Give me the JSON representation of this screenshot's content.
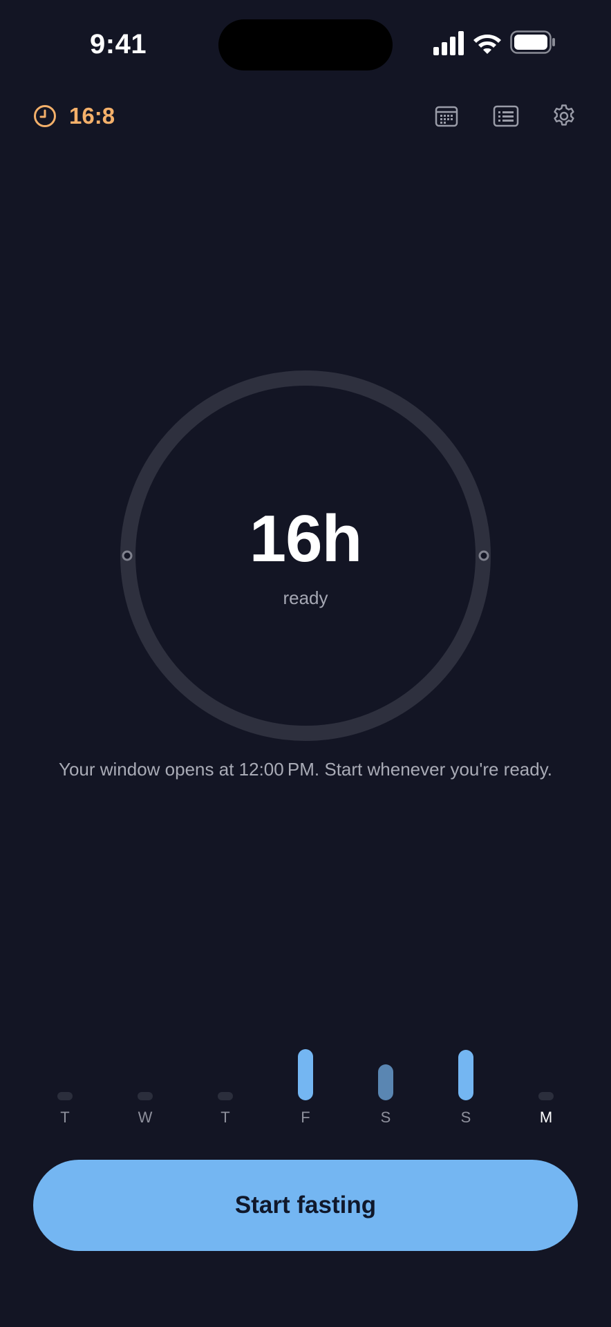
{
  "status_bar": {
    "time": "9:41"
  },
  "header": {
    "plan_label": "16:8",
    "plan_icon": "clock-icon",
    "icons": [
      "calendar-icon",
      "list-icon",
      "gear-icon"
    ]
  },
  "timer": {
    "value": "16h",
    "status": "ready",
    "progress": 0
  },
  "window_message": "Your window opens at 12:00 PM. Start whenever you're ready.",
  "week": {
    "days": [
      {
        "letter": "T",
        "level": 0,
        "shade": "empty"
      },
      {
        "letter": "W",
        "level": 0,
        "shade": "empty"
      },
      {
        "letter": "T",
        "level": 0,
        "shade": "empty"
      },
      {
        "letter": "F",
        "level": 1.0,
        "shade": "full"
      },
      {
        "letter": "S",
        "level": 0.7,
        "shade": "partial"
      },
      {
        "letter": "S",
        "level": 0.98,
        "shade": "full"
      },
      {
        "letter": "M",
        "level": 0,
        "shade": "empty",
        "current": true
      }
    ]
  },
  "actions": {
    "start_label": "Start fasting"
  },
  "colors": {
    "background": "#131524",
    "accent_orange": "#f4b06a",
    "accent_blue": "#74b6f2",
    "bar_partial": "#5a86b2",
    "bar_empty": "#2b2e3c",
    "ring_track": "#2e303e"
  }
}
